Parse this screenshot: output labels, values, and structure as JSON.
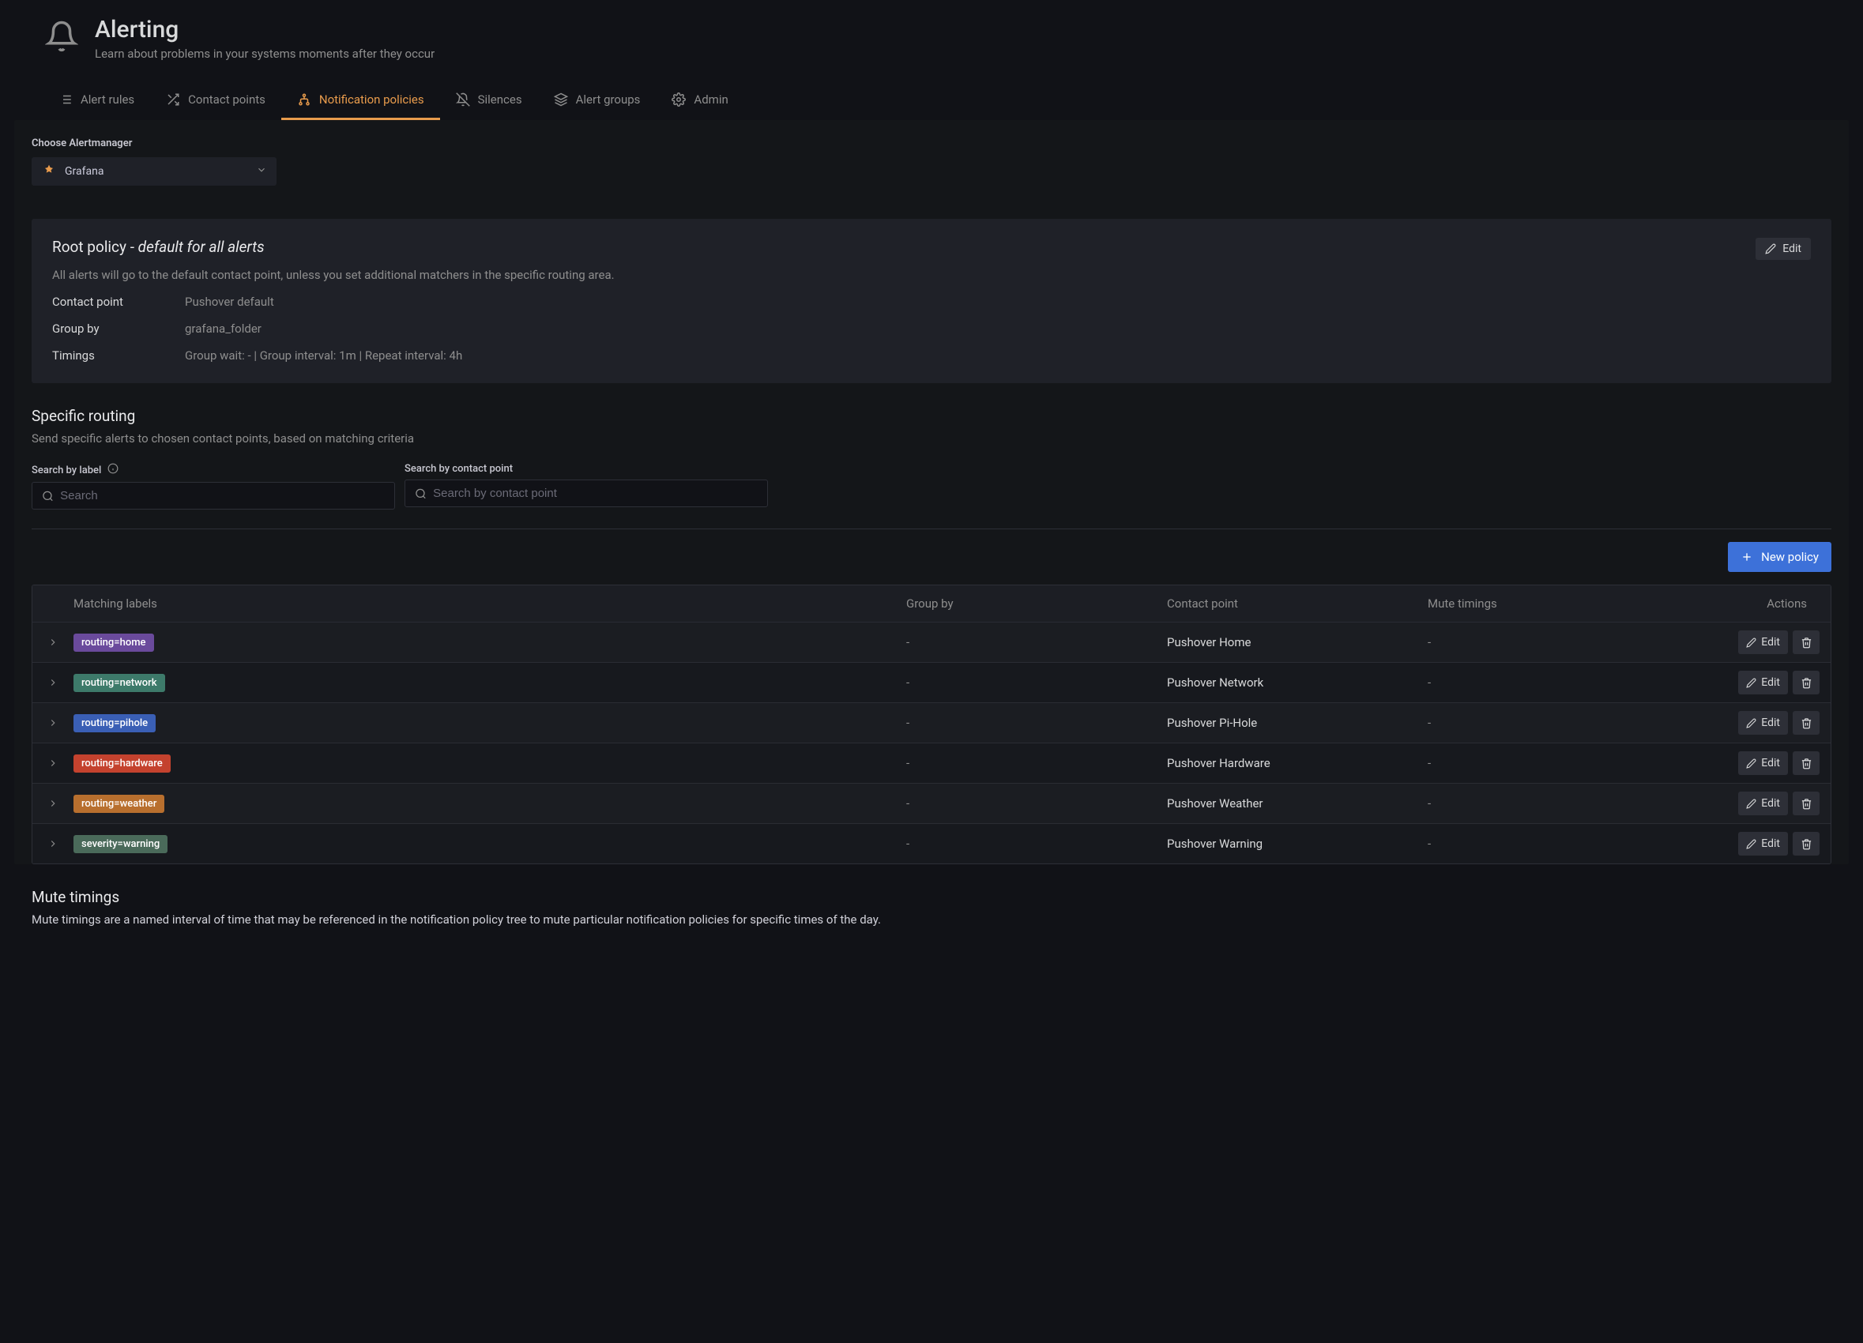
{
  "header": {
    "title": "Alerting",
    "subtitle": "Learn about problems in your systems moments after they occur"
  },
  "tabs": [
    {
      "label": "Alert rules"
    },
    {
      "label": "Contact points"
    },
    {
      "label": "Notification policies"
    },
    {
      "label": "Silences"
    },
    {
      "label": "Alert groups"
    },
    {
      "label": "Admin"
    }
  ],
  "choose_label": "Choose Alertmanager",
  "alertmanager_selected": "Grafana",
  "root_policy": {
    "title_prefix": "Root policy - ",
    "title_italic": "default for all alerts",
    "edit_label": "Edit",
    "description": "All alerts will go to the default contact point, unless you set additional matchers in the specific routing area.",
    "contact_label": "Contact point",
    "contact_value": "Pushover default",
    "groupby_label": "Group by",
    "groupby_value": "grafana_folder",
    "timings_label": "Timings",
    "timings_value": "Group wait: - | Group interval: 1m | Repeat interval: 4h"
  },
  "specific": {
    "title": "Specific routing",
    "desc": "Send specific alerts to chosen contact points, based on matching criteria",
    "search_label_label": "Search by label",
    "search_label_placeholder": "Search",
    "search_cp_label": "Search by contact point",
    "search_cp_placeholder": "Search by contact point"
  },
  "new_policy_label": "New policy",
  "columns": {
    "matching": "Matching labels",
    "groupby": "Group by",
    "contact": "Contact point",
    "mute": "Mute timings",
    "actions": "Actions"
  },
  "edit_label": "Edit",
  "rows": [
    {
      "badge": "routing=home",
      "color": "#6a4a9c",
      "groupby": "-",
      "contact": "Pushover Home",
      "mute": "-"
    },
    {
      "badge": "routing=network",
      "color": "#3d7a6a",
      "groupby": "-",
      "contact": "Pushover Network",
      "mute": "-"
    },
    {
      "badge": "routing=pihole",
      "color": "#3a5fb5",
      "groupby": "-",
      "contact": "Pushover Pi-Hole",
      "mute": "-"
    },
    {
      "badge": "routing=hardware",
      "color": "#c4422e",
      "groupby": "-",
      "contact": "Pushover Hardware",
      "mute": "-"
    },
    {
      "badge": "routing=weather",
      "color": "#b86f2e",
      "groupby": "-",
      "contact": "Pushover Weather",
      "mute": "-"
    },
    {
      "badge": "severity=warning",
      "color": "#4a6a5a",
      "groupby": "-",
      "contact": "Pushover Warning",
      "mute": "-"
    }
  ],
  "mute": {
    "title": "Mute timings",
    "desc": "Mute timings are a named interval of time that may be referenced in the notification policy tree to mute particular notification policies for specific times of the day."
  }
}
